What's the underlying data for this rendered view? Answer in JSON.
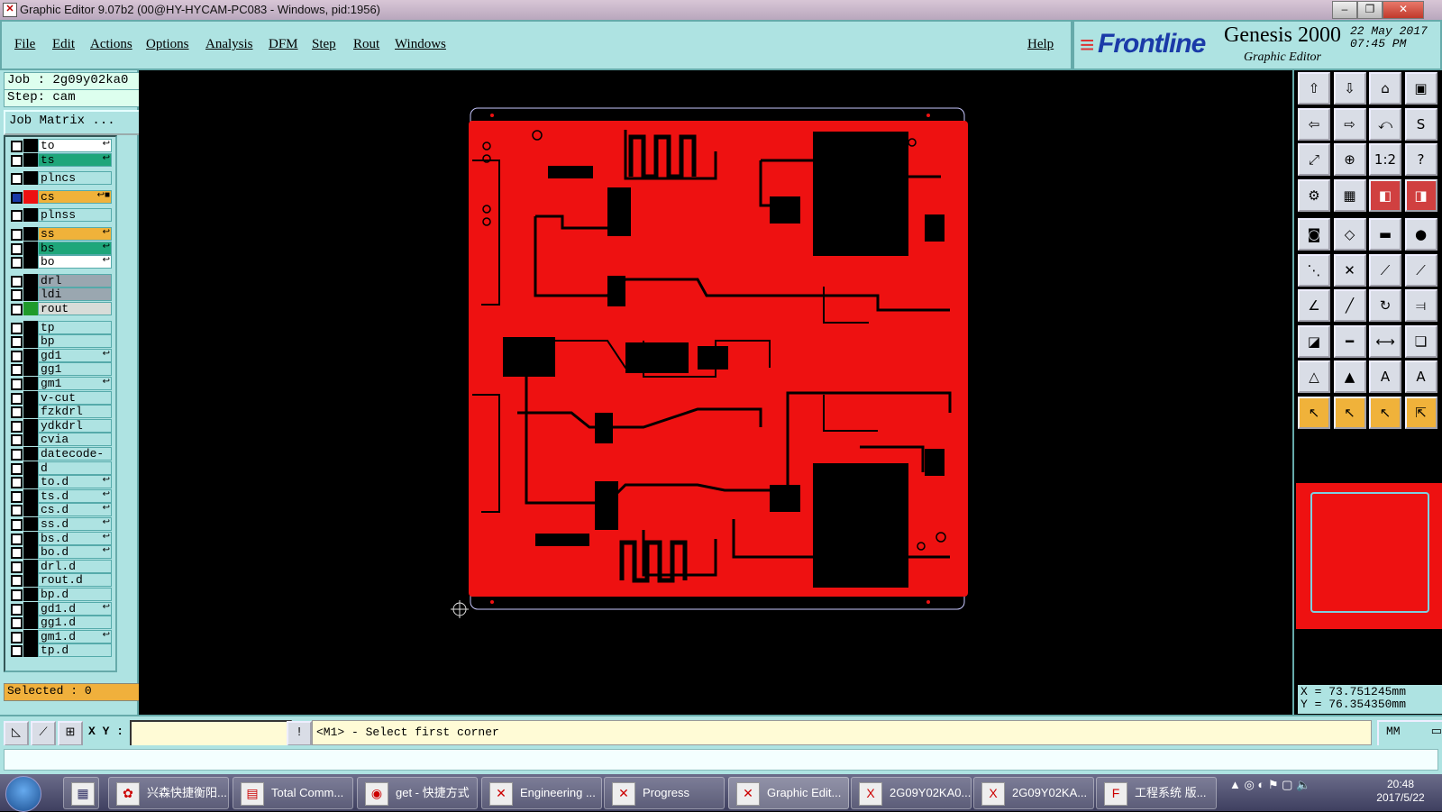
{
  "window": {
    "title": "Graphic Editor 9.07b2 (00@HY-HYCAM-PC083 - Windows, pid:1956)",
    "min_glyph": "‒",
    "max_glyph": "❐",
    "close_glyph": "✕"
  },
  "menu": {
    "items": [
      "File",
      "Edit",
      "Actions",
      "Options",
      "Analysis",
      "DFM",
      "Step",
      "Rout",
      "Windows"
    ],
    "help": "Help"
  },
  "brand": {
    "mark": "≡",
    "name": "Frontline",
    "product": "Genesis 2000",
    "subtitle": "Graphic Editor",
    "date": "22 May 2017",
    "time": "07:45 PM"
  },
  "job": {
    "job_line": "Job : 2g09y02ka0",
    "step_line": "Step: cam",
    "matrix_button": "Job Matrix ...",
    "selected": "Selected : 0"
  },
  "layers": [
    {
      "name": "to",
      "bg": "#ffffff",
      "swatch": "#000000",
      "flag": "↩"
    },
    {
      "name": "ts",
      "bg": "#1ea67a",
      "swatch": "#000000",
      "flag": "↩"
    },
    {
      "name": "plncs",
      "bg": "#aee3e2",
      "swatch": "#000000",
      "flag": ""
    },
    {
      "name": "cs",
      "bg": "#f0b23a",
      "swatch": "#ee1111",
      "flag": "↩■",
      "active": true
    },
    {
      "name": "plnss",
      "bg": "#aee3e2",
      "swatch": "#000000",
      "flag": ""
    },
    {
      "name": "ss",
      "bg": "#f0b23a",
      "swatch": "#000000",
      "flag": "↩"
    },
    {
      "name": "bs",
      "bg": "#1ea67a",
      "swatch": "#000000",
      "flag": "↩"
    },
    {
      "name": "bo",
      "bg": "#ffffff",
      "swatch": "#000000",
      "flag": "↩"
    },
    {
      "name": "drl",
      "bg": "#9aa7b0",
      "swatch": "#000000",
      "flag": ""
    },
    {
      "name": "ldi",
      "bg": "#9aa7b0",
      "swatch": "#000000",
      "flag": ""
    },
    {
      "name": "rout",
      "bg": "#d8dcd8",
      "swatch": "#1e9a2a",
      "flag": ""
    },
    {
      "name": "tp",
      "bg": "#aee3e2",
      "swatch": "#000000",
      "flag": ""
    },
    {
      "name": "bp",
      "bg": "#aee3e2",
      "swatch": "#000000",
      "flag": ""
    },
    {
      "name": "gd1",
      "bg": "#aee3e2",
      "swatch": "#000000",
      "flag": "↩"
    },
    {
      "name": "gg1",
      "bg": "#aee3e2",
      "swatch": "#000000",
      "flag": ""
    },
    {
      "name": "gm1",
      "bg": "#aee3e2",
      "swatch": "#000000",
      "flag": "↩"
    },
    {
      "name": "v-cut",
      "bg": "#aee3e2",
      "swatch": "#000000",
      "flag": ""
    },
    {
      "name": "fzkdrl",
      "bg": "#aee3e2",
      "swatch": "#000000",
      "flag": ""
    },
    {
      "name": "ydkdrl",
      "bg": "#aee3e2",
      "swatch": "#000000",
      "flag": ""
    },
    {
      "name": "cvia",
      "bg": "#aee3e2",
      "swatch": "#000000",
      "flag": ""
    },
    {
      "name": "datecode-to",
      "bg": "#aee3e2",
      "swatch": "#000000",
      "flag": ""
    },
    {
      "name": "d",
      "bg": "#aee3e2",
      "swatch": "#000000",
      "flag": ""
    },
    {
      "name": "to.d",
      "bg": "#aee3e2",
      "swatch": "#000000",
      "flag": "↩"
    },
    {
      "name": "ts.d",
      "bg": "#aee3e2",
      "swatch": "#000000",
      "flag": "↩"
    },
    {
      "name": "cs.d",
      "bg": "#aee3e2",
      "swatch": "#000000",
      "flag": "↩"
    },
    {
      "name": "ss.d",
      "bg": "#aee3e2",
      "swatch": "#000000",
      "flag": "↩"
    },
    {
      "name": "bs.d",
      "bg": "#aee3e2",
      "swatch": "#000000",
      "flag": "↩"
    },
    {
      "name": "bo.d",
      "bg": "#aee3e2",
      "swatch": "#000000",
      "flag": "↩"
    },
    {
      "name": "drl.d",
      "bg": "#aee3e2",
      "swatch": "#000000",
      "flag": ""
    },
    {
      "name": "rout.d",
      "bg": "#aee3e2",
      "swatch": "#000000",
      "flag": ""
    },
    {
      "name": "bp.d",
      "bg": "#aee3e2",
      "swatch": "#000000",
      "flag": ""
    },
    {
      "name": "gd1.d",
      "bg": "#aee3e2",
      "swatch": "#000000",
      "flag": "↩"
    },
    {
      "name": "gg1.d",
      "bg": "#aee3e2",
      "swatch": "#000000",
      "flag": ""
    },
    {
      "name": "gm1.d",
      "bg": "#aee3e2",
      "swatch": "#000000",
      "flag": "↩"
    },
    {
      "name": "tp.d",
      "bg": "#aee3e2",
      "swatch": "#000000",
      "flag": ""
    }
  ],
  "tools": [
    {
      "icon": "move-up-icon",
      "glyph": "⇧",
      "style": ""
    },
    {
      "icon": "move-down-icon",
      "glyph": "⇩",
      "style": ""
    },
    {
      "icon": "home-icon",
      "glyph": "⌂",
      "style": ""
    },
    {
      "icon": "window-icon",
      "glyph": "▣",
      "style": ""
    },
    {
      "icon": "move-left-icon",
      "glyph": "⇦",
      "style": ""
    },
    {
      "icon": "move-right-icon",
      "glyph": "⇨",
      "style": ""
    },
    {
      "icon": "back-icon",
      "glyph": "⤺",
      "style": ""
    },
    {
      "icon": "redraw-icon",
      "glyph": "S",
      "style": ""
    },
    {
      "icon": "zoom-fit-icon",
      "glyph": "⤢",
      "style": ""
    },
    {
      "icon": "zoom-home-icon",
      "glyph": "⊕",
      "style": ""
    },
    {
      "icon": "scale-icon",
      "glyph": "1:2",
      "style": ""
    },
    {
      "icon": "help-icon",
      "glyph": "?",
      "style": ""
    },
    {
      "icon": "snap-icon",
      "glyph": "⚙",
      "style": ""
    },
    {
      "icon": "grid-icon",
      "glyph": "▦",
      "style": ""
    },
    {
      "icon": "layer-red-icon",
      "glyph": "◧",
      "style": "red"
    },
    {
      "icon": "layer-red-2-icon",
      "glyph": "◨",
      "style": "red"
    },
    {
      "icon": "pad-icon",
      "glyph": "◙",
      "style": ""
    },
    {
      "icon": "shape-icon",
      "glyph": "◇",
      "style": ""
    },
    {
      "icon": "ruler-icon",
      "glyph": "▬",
      "style": ""
    },
    {
      "icon": "dot-icon",
      "glyph": "●",
      "style": ""
    },
    {
      "icon": "nodes-icon",
      "glyph": "⋱",
      "style": ""
    },
    {
      "icon": "cross-icon",
      "glyph": "✕",
      "style": ""
    },
    {
      "icon": "line-icon",
      "glyph": "⟋",
      "style": ""
    },
    {
      "icon": "line-red-icon",
      "glyph": "⟋",
      "style": ""
    },
    {
      "icon": "angle-icon",
      "glyph": "∠",
      "style": ""
    },
    {
      "icon": "draw-line-icon",
      "glyph": "╱",
      "style": ""
    },
    {
      "icon": "arc-icon",
      "glyph": "↻",
      "style": ""
    },
    {
      "icon": "split-icon",
      "glyph": "⫤",
      "style": ""
    },
    {
      "icon": "pad-add-icon",
      "glyph": "◪",
      "style": ""
    },
    {
      "icon": "dash-icon",
      "glyph": "━",
      "style": ""
    },
    {
      "icon": "measure-icon",
      "glyph": "⟷",
      "style": ""
    },
    {
      "icon": "copy-icon",
      "glyph": "❏",
      "style": ""
    },
    {
      "icon": "triangle-1-icon",
      "glyph": "△",
      "style": ""
    },
    {
      "icon": "triangle-2-icon",
      "glyph": "▲",
      "style": ""
    },
    {
      "icon": "triangle-3-icon",
      "glyph": "A",
      "style": ""
    },
    {
      "icon": "triangle-4-icon",
      "glyph": "A",
      "style": ""
    },
    {
      "icon": "pointer-icon",
      "glyph": "↖",
      "style": "yellow"
    },
    {
      "icon": "pointer-2-icon",
      "glyph": "↖",
      "style": "yellow"
    },
    {
      "icon": "pointer-3-icon",
      "glyph": "↖",
      "style": "yellow"
    },
    {
      "icon": "pointer-multi-icon",
      "glyph": "⇱",
      "style": "yellow"
    }
  ],
  "coords": {
    "x": "X = 73.751245mm",
    "y": "Y = 76.354350mm"
  },
  "command": {
    "xy_label": "X Y :",
    "xy_value": "",
    "prompt": "<M1> - Select first corner",
    "units": "MM",
    "units_glyph": "▭"
  },
  "taskbar": {
    "items": [
      {
        "label": "兴森快捷衡阳...",
        "icon": "app-icon",
        "glyph": "✿"
      },
      {
        "label": "Total Comm...",
        "icon": "floppy-icon",
        "glyph": "▤"
      },
      {
        "label": "get - 快捷方式",
        "icon": "eye-icon",
        "glyph": "◉"
      },
      {
        "label": "Engineering ...",
        "icon": "genesis-icon",
        "glyph": "✕"
      },
      {
        "label": "Progress",
        "icon": "genesis-icon",
        "glyph": "✕"
      },
      {
        "label": "Graphic Edit...",
        "icon": "genesis-icon",
        "glyph": "✕",
        "active": true
      },
      {
        "label": "2G09Y02KA0...",
        "icon": "excel-icon",
        "glyph": "X"
      },
      {
        "label": "2G09Y02KA...",
        "icon": "excel-icon",
        "glyph": "X"
      },
      {
        "label": "工程系统   版...",
        "icon": "app-f-icon",
        "glyph": "F"
      }
    ],
    "time": "20:48",
    "date": "2017/5/22",
    "tray_glyphs": "▲  ◎  ◐  ⚑  ▢  🔈"
  }
}
